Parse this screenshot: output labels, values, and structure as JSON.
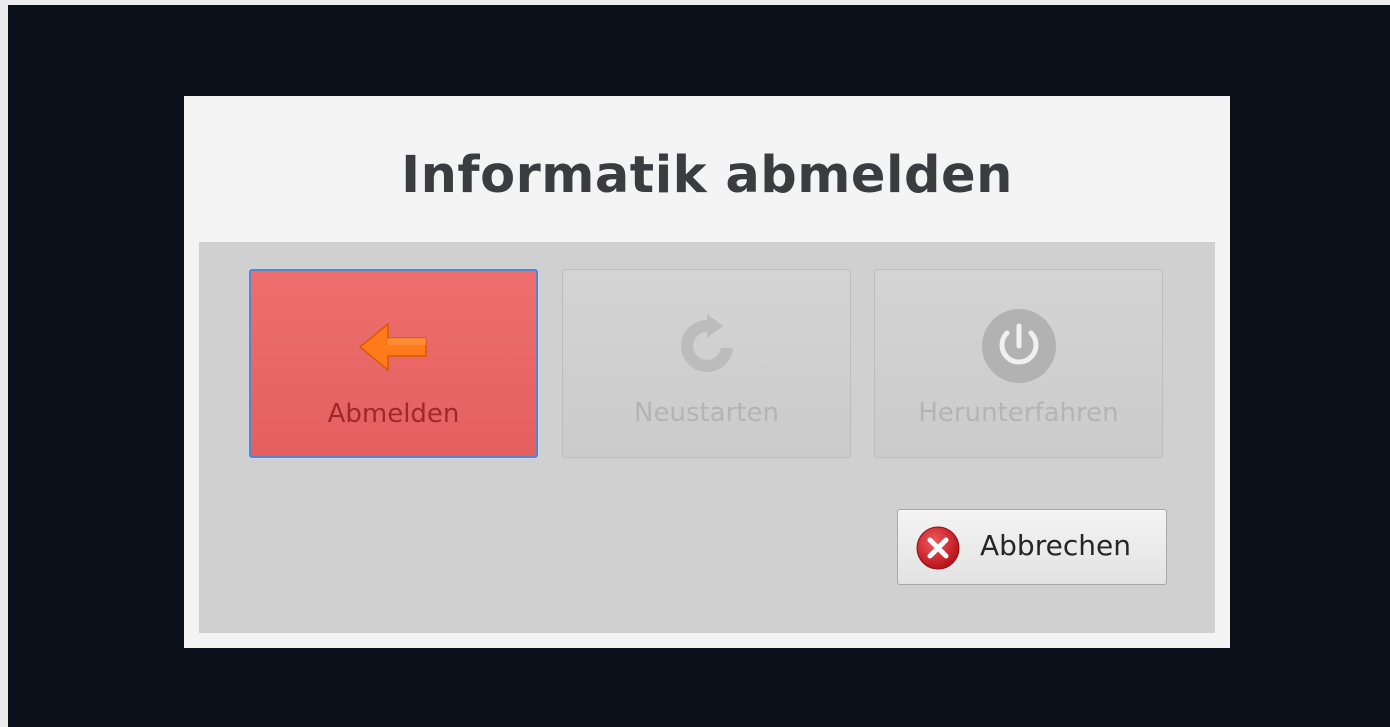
{
  "dialog": {
    "title": "Informatik abmelden",
    "actions": [
      {
        "label": "Abmelden",
        "icon": "logout-arrow-icon",
        "state": "selected",
        "color": "#e86666"
      },
      {
        "label": "Neustarten",
        "icon": "restart-icon",
        "state": "disabled"
      },
      {
        "label": "Herunterfahren",
        "icon": "power-icon",
        "state": "disabled"
      }
    ],
    "cancel": {
      "label": "Abbrechen",
      "icon": "cancel-icon",
      "color": "#d7262e"
    }
  }
}
